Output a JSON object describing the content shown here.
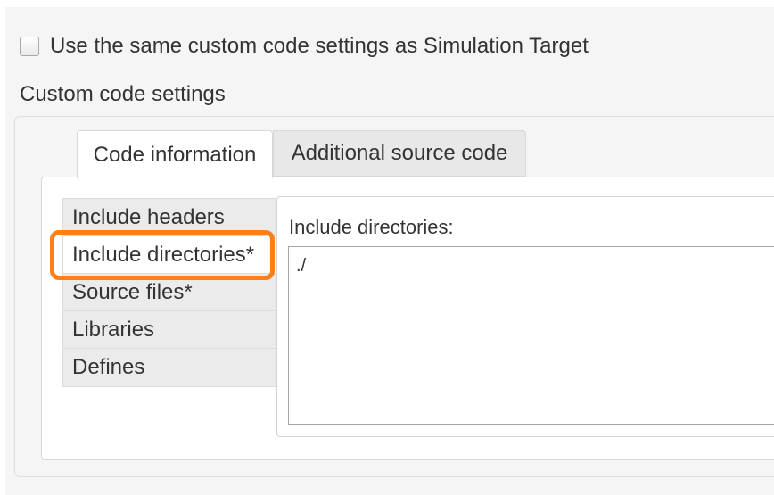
{
  "options": {
    "same_settings_label": "Use the same custom code settings as Simulation Target",
    "same_settings_checked": false
  },
  "custom_code": {
    "section_title": "Custom code settings",
    "tabs": [
      {
        "label": "Code information",
        "active": true
      },
      {
        "label": "Additional source code",
        "active": false
      }
    ],
    "categories": [
      {
        "label": "Include headers",
        "selected": false
      },
      {
        "label": "Include directories*",
        "selected": true
      },
      {
        "label": "Source files*",
        "selected": false
      },
      {
        "label": "Libraries",
        "selected": false
      },
      {
        "label": "Defines",
        "selected": false
      }
    ],
    "detail": {
      "label": "Include directories:",
      "value": "./"
    }
  },
  "colors": {
    "highlight": "#ff7f1a"
  }
}
